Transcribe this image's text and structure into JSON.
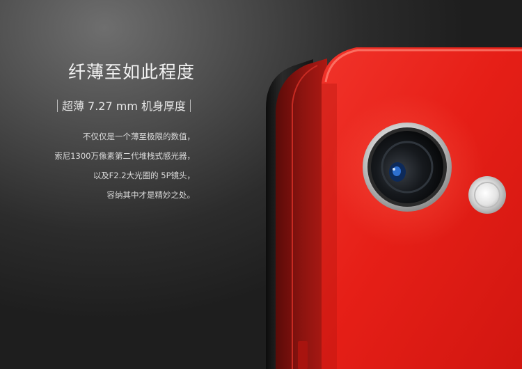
{
  "headline": "纤薄至如此程度",
  "subhead": "超薄 7.27 mm 机身厚度",
  "description": [
    "不仅仅是一个薄至极限的数值，",
    "索尼1300万像素第二代堆栈式感光器，",
    "以及F2.2大光圈的 5P镜头，",
    "容纳其中才是精妙之处。"
  ],
  "colors": {
    "phone_body": "#e8231b",
    "phone_edge": "#a81510",
    "background": "#3a3a3a"
  }
}
